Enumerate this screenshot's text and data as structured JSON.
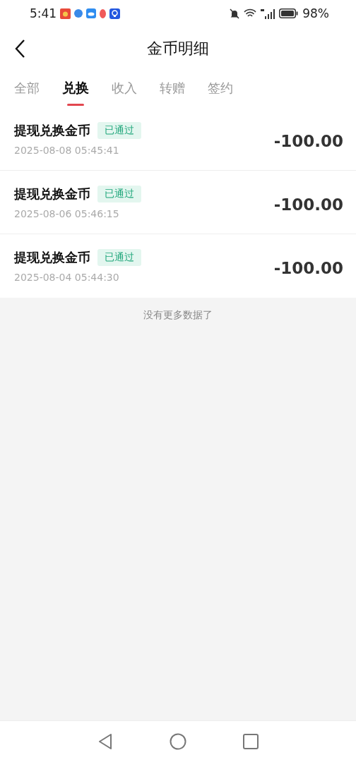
{
  "status_bar": {
    "time": "5:41",
    "battery": "98%"
  },
  "header": {
    "title": "金币明细"
  },
  "tabs": [
    {
      "label": "全部",
      "selected": false
    },
    {
      "label": "兑换",
      "selected": true
    },
    {
      "label": "收入",
      "selected": false
    },
    {
      "label": "转赠",
      "selected": false
    },
    {
      "label": "签约",
      "selected": false
    }
  ],
  "records": [
    {
      "title": "提现兑换金币",
      "status": {
        "text": "已通过",
        "kind": "approved"
      },
      "time": "2025-08-08 05:45:41",
      "amount": "-100.00"
    },
    {
      "title": "提现兑换金币",
      "status": {
        "text": "已通过",
        "kind": "approved"
      },
      "time": "2025-08-06 05:46:15",
      "amount": "-100.00"
    },
    {
      "title": "提现兑换金币",
      "status": {
        "text": "已通过",
        "kind": "approved"
      },
      "time": "2025-08-04 05:44:30",
      "amount": "-100.00"
    }
  ],
  "end_note": "没有更多数据了"
}
